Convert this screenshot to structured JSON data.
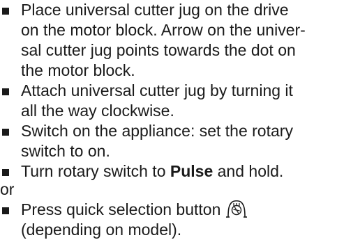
{
  "steps": [
    {
      "lines": [
        "Place universal cutter jug on the drive",
        "on the motor block. Arrow on the univer-",
        "sal cutter jug points towards the dot on",
        "the motor block."
      ]
    },
    {
      "lines": [
        "Attach universal cutter jug by turning it",
        "all the way clockwise."
      ]
    },
    {
      "lines": [
        "Switch on the appliance: set the rotary",
        "switch to on."
      ]
    },
    {
      "prefix": "Turn rotary switch to ",
      "bold": "Pulse",
      "suffix": " and hold."
    },
    {
      "first_line": "Press quick selection button",
      "icon": "quick-selection-button-icon",
      "second_line": "(depending on model)."
    }
  ],
  "or_text": "or"
}
